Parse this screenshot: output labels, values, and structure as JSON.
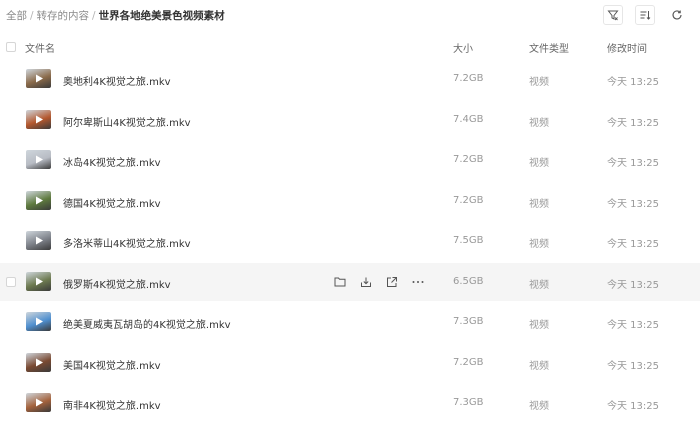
{
  "breadcrumb": {
    "items": [
      "全部",
      "转存的内容"
    ],
    "current": "世界各地绝美景色视频素材",
    "separator": "/"
  },
  "toolbar": {
    "icons": [
      "filter-icon",
      "sort-icon",
      "refresh-icon"
    ]
  },
  "columns": {
    "name": "文件名",
    "size": "大小",
    "type": "文件类型",
    "modified": "修改时间"
  },
  "files": [
    {
      "name": "奥地利4K视觉之旅.mkv",
      "size": "7.2GB",
      "type": "视频",
      "modified": "今天 13:25",
      "thumb": "#8a6a4a"
    },
    {
      "name": "阿尔卑斯山4K视觉之旅.mkv",
      "size": "7.4GB",
      "type": "视频",
      "modified": "今天 13:25",
      "thumb": "#b4582e"
    },
    {
      "name": "冰岛4K视觉之旅.mkv",
      "size": "7.2GB",
      "type": "视频",
      "modified": "今天 13:25",
      "thumb": "#b8bcc4"
    },
    {
      "name": "德国4K视觉之旅.mkv",
      "size": "7.2GB",
      "type": "视频",
      "modified": "今天 13:25",
      "thumb": "#5e7a3e"
    },
    {
      "name": "多洛米蒂山4K视觉之旅.mkv",
      "size": "7.5GB",
      "type": "视频",
      "modified": "今天 13:25",
      "thumb": "#7c8088"
    },
    {
      "name": "俄罗斯4K视觉之旅.mkv",
      "size": "6.5GB",
      "type": "视频",
      "modified": "今天 13:25",
      "thumb": "#6d7a50"
    },
    {
      "name": "绝美夏威夷瓦胡岛的4K视觉之旅.mkv",
      "size": "7.3GB",
      "type": "视频",
      "modified": "今天 13:25",
      "thumb": "#4f8fcf"
    },
    {
      "name": "美国4K视觉之旅.mkv",
      "size": "7.2GB",
      "type": "视频",
      "modified": "今天 13:25",
      "thumb": "#7a4a32"
    },
    {
      "name": "南非4K视觉之旅.mkv",
      "size": "7.3GB",
      "type": "视频",
      "modified": "今天 13:25",
      "thumb": "#a4623c"
    }
  ],
  "row_actions": [
    "folder-icon",
    "download-icon",
    "share-icon",
    "more-icon"
  ]
}
